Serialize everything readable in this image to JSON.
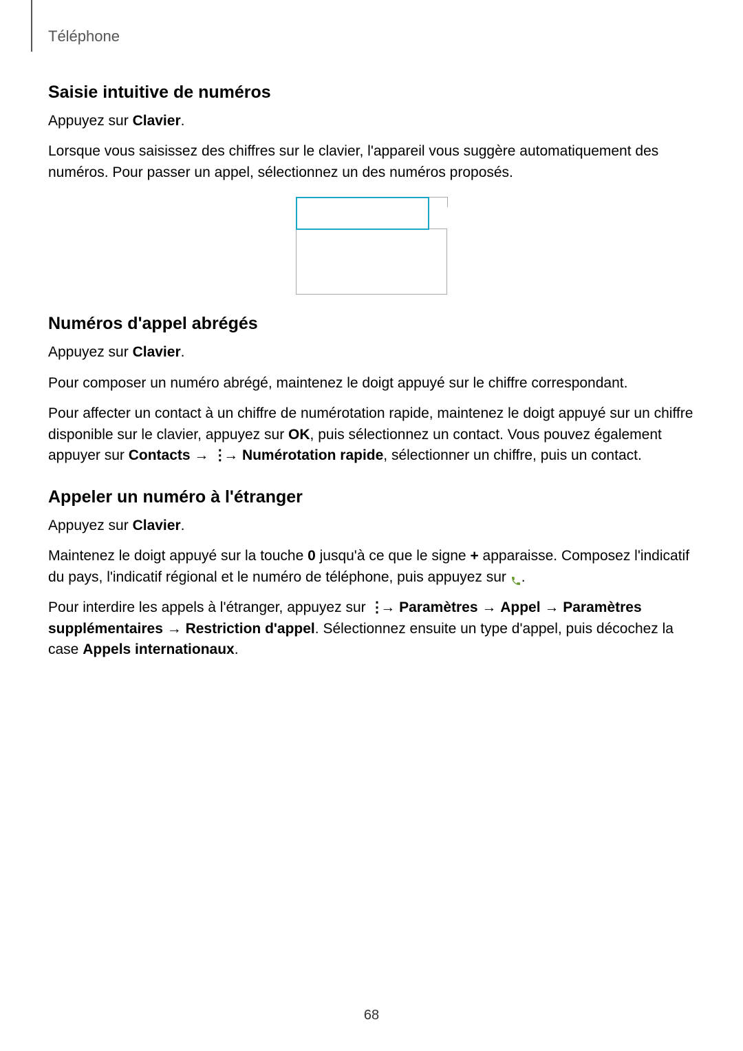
{
  "header": {
    "breadcrumb": "Téléphone"
  },
  "section1": {
    "heading": "Saisie intuitive de numéros",
    "p1_a": "Appuyez sur ",
    "p1_b": "Clavier",
    "p1_c": ".",
    "p2": "Lorsque vous saisissez des chiffres sur le clavier, l'appareil vous suggère automatiquement des numéros. Pour passer un appel, sélectionnez un des numéros proposés."
  },
  "section2": {
    "heading": "Numéros d'appel abrégés",
    "p1_a": "Appuyez sur ",
    "p1_b": "Clavier",
    "p1_c": ".",
    "p2": "Pour composer un numéro abrégé, maintenez le doigt appuyé sur le chiffre correspondant.",
    "p3_a": "Pour affecter un contact à un chiffre de numérotation rapide, maintenez le doigt appuyé sur un chiffre disponible sur le clavier, appuyez sur ",
    "p3_b": "OK",
    "p3_c": ", puis sélectionnez un contact. Vous pouvez également appuyer sur ",
    "p3_d": "Contacts",
    "p3_e": " → ",
    "p3_f": " → ",
    "p3_g": "Numérotation rapide",
    "p3_h": ", sélectionner un chiffre, puis un contact."
  },
  "section3": {
    "heading": "Appeler un numéro à l'étranger",
    "p1_a": "Appuyez sur ",
    "p1_b": "Clavier",
    "p1_c": ".",
    "p2_a": "Maintenez le doigt appuyé sur la touche ",
    "p2_b": "0",
    "p2_c": " jusqu'à ce que le signe ",
    "p2_d": "+",
    "p2_e": " apparaisse. Composez l'indicatif du pays, l'indicatif régional et le numéro de téléphone, puis appuyez sur ",
    "p2_f": ".",
    "p3_a": "Pour interdire les appels à l'étranger, appuyez sur ",
    "p3_b": " → ",
    "p3_c": "Paramètres",
    "p3_d": " → ",
    "p3_e": "Appel",
    "p3_f": " → ",
    "p3_g": "Paramètres supplémentaires",
    "p3_h": " → ",
    "p3_i": "Restriction d'appel",
    "p3_j": ". Sélectionnez ensuite un type d'appel, puis décochez la case ",
    "p3_k": "Appels internationaux",
    "p3_l": "."
  },
  "page_number": "68",
  "icons": {
    "call": "call-icon",
    "more": "more-icon"
  }
}
